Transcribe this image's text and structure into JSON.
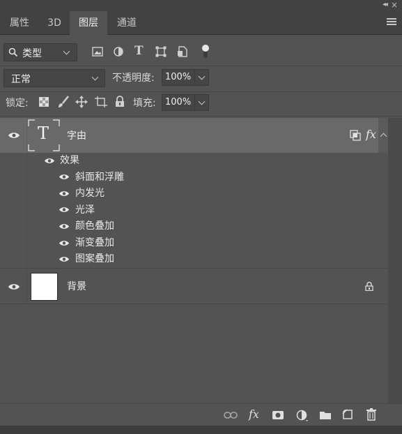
{
  "tabs": [
    {
      "label": "属性"
    },
    {
      "label": "3D"
    },
    {
      "label": "图层"
    },
    {
      "label": "通道"
    }
  ],
  "filter": {
    "kind_label": "类型"
  },
  "blend": {
    "mode": "正常",
    "opacity_label": "不透明度:",
    "opacity_value": "100%"
  },
  "lock": {
    "label": "锁定:",
    "fill_label": "填充:",
    "fill_value": "100%"
  },
  "layers": {
    "text_layer": {
      "name": "字由",
      "thumb_glyph": "T",
      "fx": "fx"
    },
    "effects_label": "效果",
    "effects": [
      "斜面和浮雕",
      "内发光",
      "光泽",
      "颜色叠加",
      "渐变叠加",
      "图案叠加"
    ],
    "background_layer": {
      "name": "背景"
    }
  },
  "footer": {
    "fx": "fx"
  }
}
